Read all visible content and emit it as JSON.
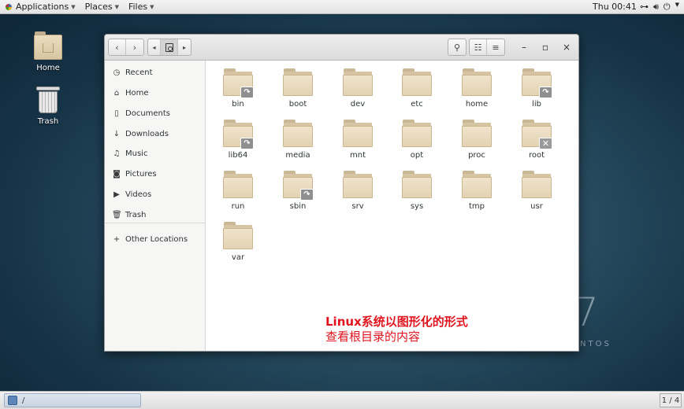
{
  "topbar": {
    "applications": "Applications",
    "places": "Places",
    "files": "Files",
    "clock": "Thu 00:41"
  },
  "desktop": {
    "home_label": "Home",
    "trash_label": "Trash",
    "watermark_number": "7",
    "watermark_text": "NTOS"
  },
  "sidebar": {
    "items": [
      {
        "label": "Recent",
        "icon": "clock-icon"
      },
      {
        "label": "Home",
        "icon": "home-icon"
      },
      {
        "label": "Documents",
        "icon": "document-icon"
      },
      {
        "label": "Downloads",
        "icon": "download-icon"
      },
      {
        "label": "Music",
        "icon": "music-icon"
      },
      {
        "label": "Pictures",
        "icon": "camera-icon"
      },
      {
        "label": "Videos",
        "icon": "video-icon"
      },
      {
        "label": "Trash",
        "icon": "trash-icon"
      }
    ],
    "other_locations": "Other Locations"
  },
  "folders": [
    {
      "name": "bin",
      "emblem": "link"
    },
    {
      "name": "boot",
      "emblem": ""
    },
    {
      "name": "dev",
      "emblem": ""
    },
    {
      "name": "etc",
      "emblem": ""
    },
    {
      "name": "home",
      "emblem": ""
    },
    {
      "name": "lib",
      "emblem": "link"
    },
    {
      "name": "lib64",
      "emblem": "link"
    },
    {
      "name": "media",
      "emblem": ""
    },
    {
      "name": "mnt",
      "emblem": ""
    },
    {
      "name": "opt",
      "emblem": ""
    },
    {
      "name": "proc",
      "emblem": ""
    },
    {
      "name": "root",
      "emblem": "locked"
    },
    {
      "name": "run",
      "emblem": ""
    },
    {
      "name": "sbin",
      "emblem": "link"
    },
    {
      "name": "srv",
      "emblem": ""
    },
    {
      "name": "sys",
      "emblem": ""
    },
    {
      "name": "tmp",
      "emblem": ""
    },
    {
      "name": "usr",
      "emblem": ""
    },
    {
      "name": "var",
      "emblem": ""
    }
  ],
  "annotation": {
    "line1": "Linux系统以图形化的形式",
    "line2": "查看根目录的内容",
    "color": "#e0141e"
  },
  "taskbar": {
    "task_label": "/",
    "pager": "1 / 4"
  }
}
